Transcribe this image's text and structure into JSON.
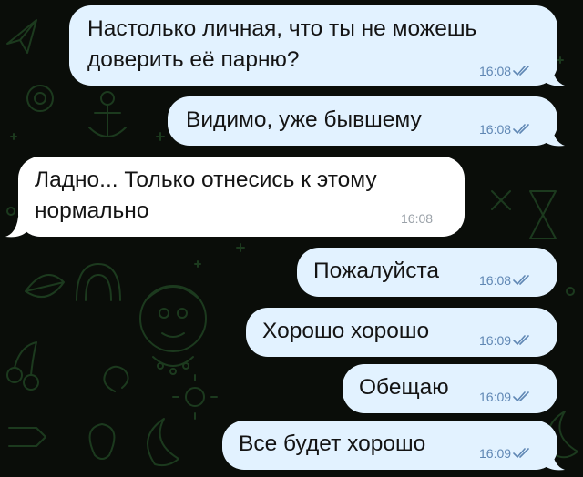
{
  "chat": {
    "messages": [
      {
        "direction": "outgoing",
        "lines": [
          "Настолько личная, что ты не можешь",
          "доверить её парню?"
        ],
        "time": "16:08",
        "status": "read"
      },
      {
        "direction": "outgoing",
        "lines": [
          "Видимо, уже бывшему"
        ],
        "time": "16:08",
        "status": "read"
      },
      {
        "direction": "incoming",
        "lines": [
          "Ладно... Только отнесись к этому",
          "нормально"
        ],
        "time": "16:08",
        "status": ""
      },
      {
        "direction": "outgoing",
        "lines": [
          "Пожалуйста"
        ],
        "time": "16:08",
        "status": "read"
      },
      {
        "direction": "outgoing",
        "lines": [
          "Хорошо хорошо"
        ],
        "time": "16:09",
        "status": "read"
      },
      {
        "direction": "outgoing",
        "lines": [
          "Обещаю"
        ],
        "time": "16:09",
        "status": "read"
      },
      {
        "direction": "outgoing",
        "lines": [
          "Все будет хорошо"
        ],
        "time": "16:09",
        "status": "read"
      }
    ]
  },
  "colors": {
    "background": "#0a0d09",
    "outgoing_bubble": "#e2f2ff",
    "incoming_bubble": "#ffffff",
    "outgoing_time": "#5f87b4",
    "incoming_time": "#9aa1a8",
    "doodle_stroke": "#1c3a1e"
  },
  "icons": {
    "read_status": "double-check-icon",
    "wallpaper": "doodle-pattern"
  }
}
